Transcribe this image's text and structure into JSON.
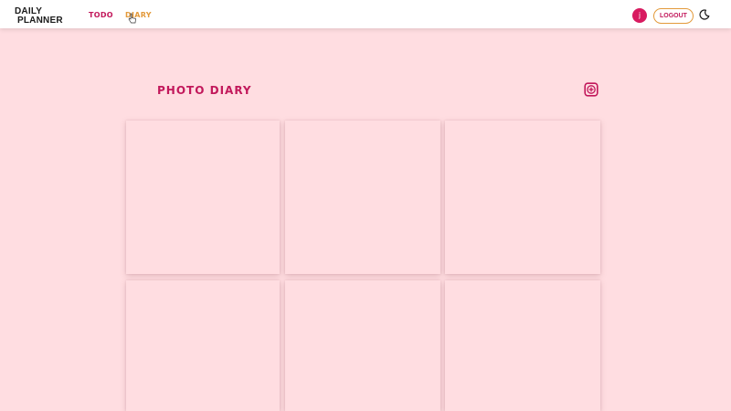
{
  "header": {
    "brand_line1": "DAILY",
    "brand_line2": "PLANNER",
    "nav": [
      {
        "label": "TODO"
      },
      {
        "label": "DIARY"
      }
    ],
    "user_initial": "j",
    "logout_label": "LOGOUT"
  },
  "main": {
    "title": "PHOTO DIARY",
    "add_icon": "plus-square-icon",
    "photo_count": 6
  },
  "colors": {
    "background": "#ffdde1",
    "accent": "#c2185b",
    "secondary": "#e39a3b",
    "header": "#ffffff"
  }
}
